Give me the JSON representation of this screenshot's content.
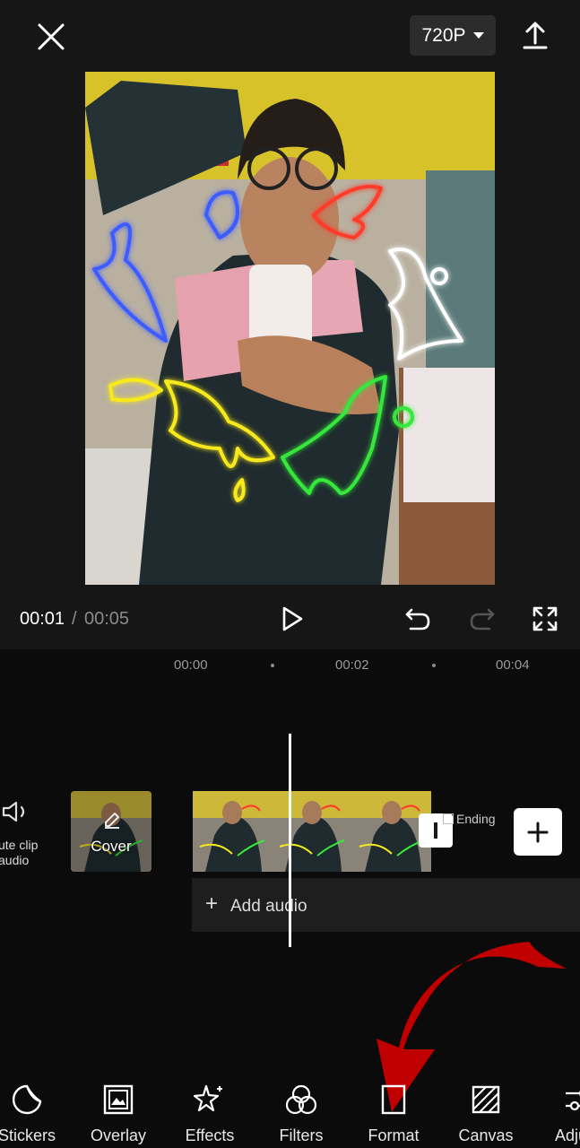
{
  "header": {
    "resolution": "720P"
  },
  "player": {
    "current_time": "00:01",
    "separator": "/",
    "total_time": "00:05"
  },
  "ruler": {
    "ticks": [
      "00:00",
      "00:02",
      "00:04"
    ]
  },
  "timeline": {
    "mute_label_line1": "ute clip",
    "mute_label_line2": "audio",
    "cover_label": "Cover",
    "ending_label": "Ending",
    "add_audio_label": "Add audio"
  },
  "toolbar": {
    "items": [
      {
        "label": "Stickers",
        "icon": "sticker-icon"
      },
      {
        "label": "Overlay",
        "icon": "overlay-icon"
      },
      {
        "label": "Effects",
        "icon": "effects-star-icon"
      },
      {
        "label": "Filters",
        "icon": "filters-icon"
      },
      {
        "label": "Format",
        "icon": "format-icon"
      },
      {
        "label": "Canvas",
        "icon": "canvas-icon"
      },
      {
        "label": "Adju",
        "icon": "adjust-icon"
      }
    ]
  },
  "colors": {
    "background": "#0b0b0b",
    "annotation_arrow": "#c00000"
  }
}
